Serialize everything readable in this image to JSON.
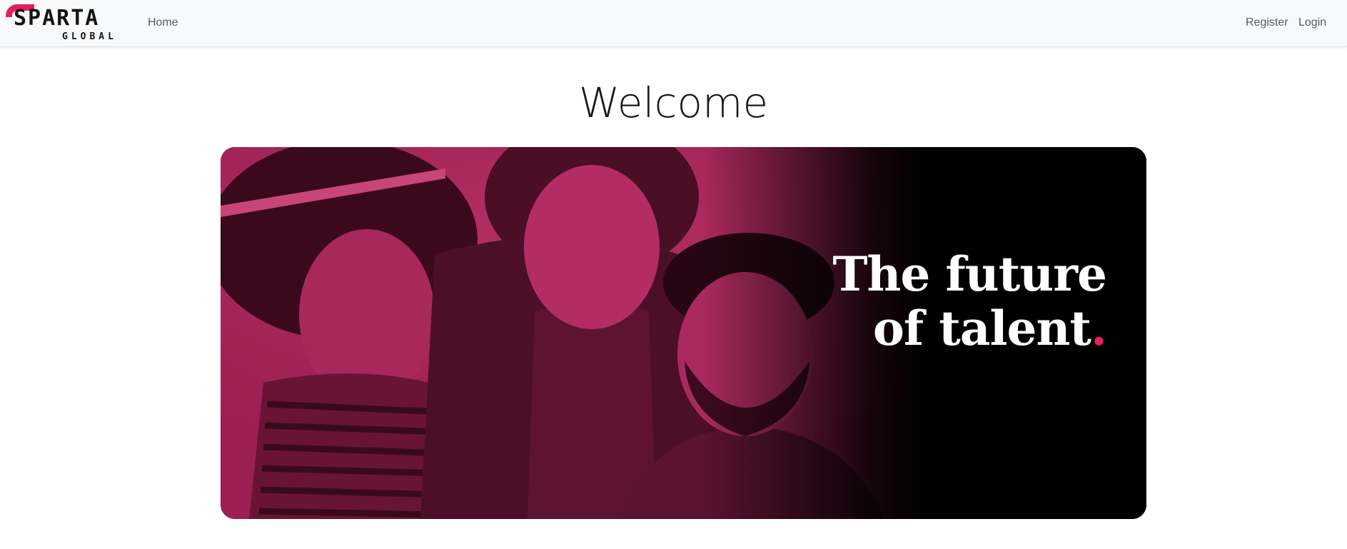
{
  "brand": {
    "word": "SPARTA",
    "sub": "GLOBAL",
    "accent_color": "#e61e5f"
  },
  "nav": {
    "home": "Home",
    "register": "Register",
    "login": "Login"
  },
  "main": {
    "title": "Welcome"
  },
  "hero": {
    "line1": "The future",
    "line2": "of talent",
    "dot": ".",
    "tint_color": "#9b1f52"
  }
}
